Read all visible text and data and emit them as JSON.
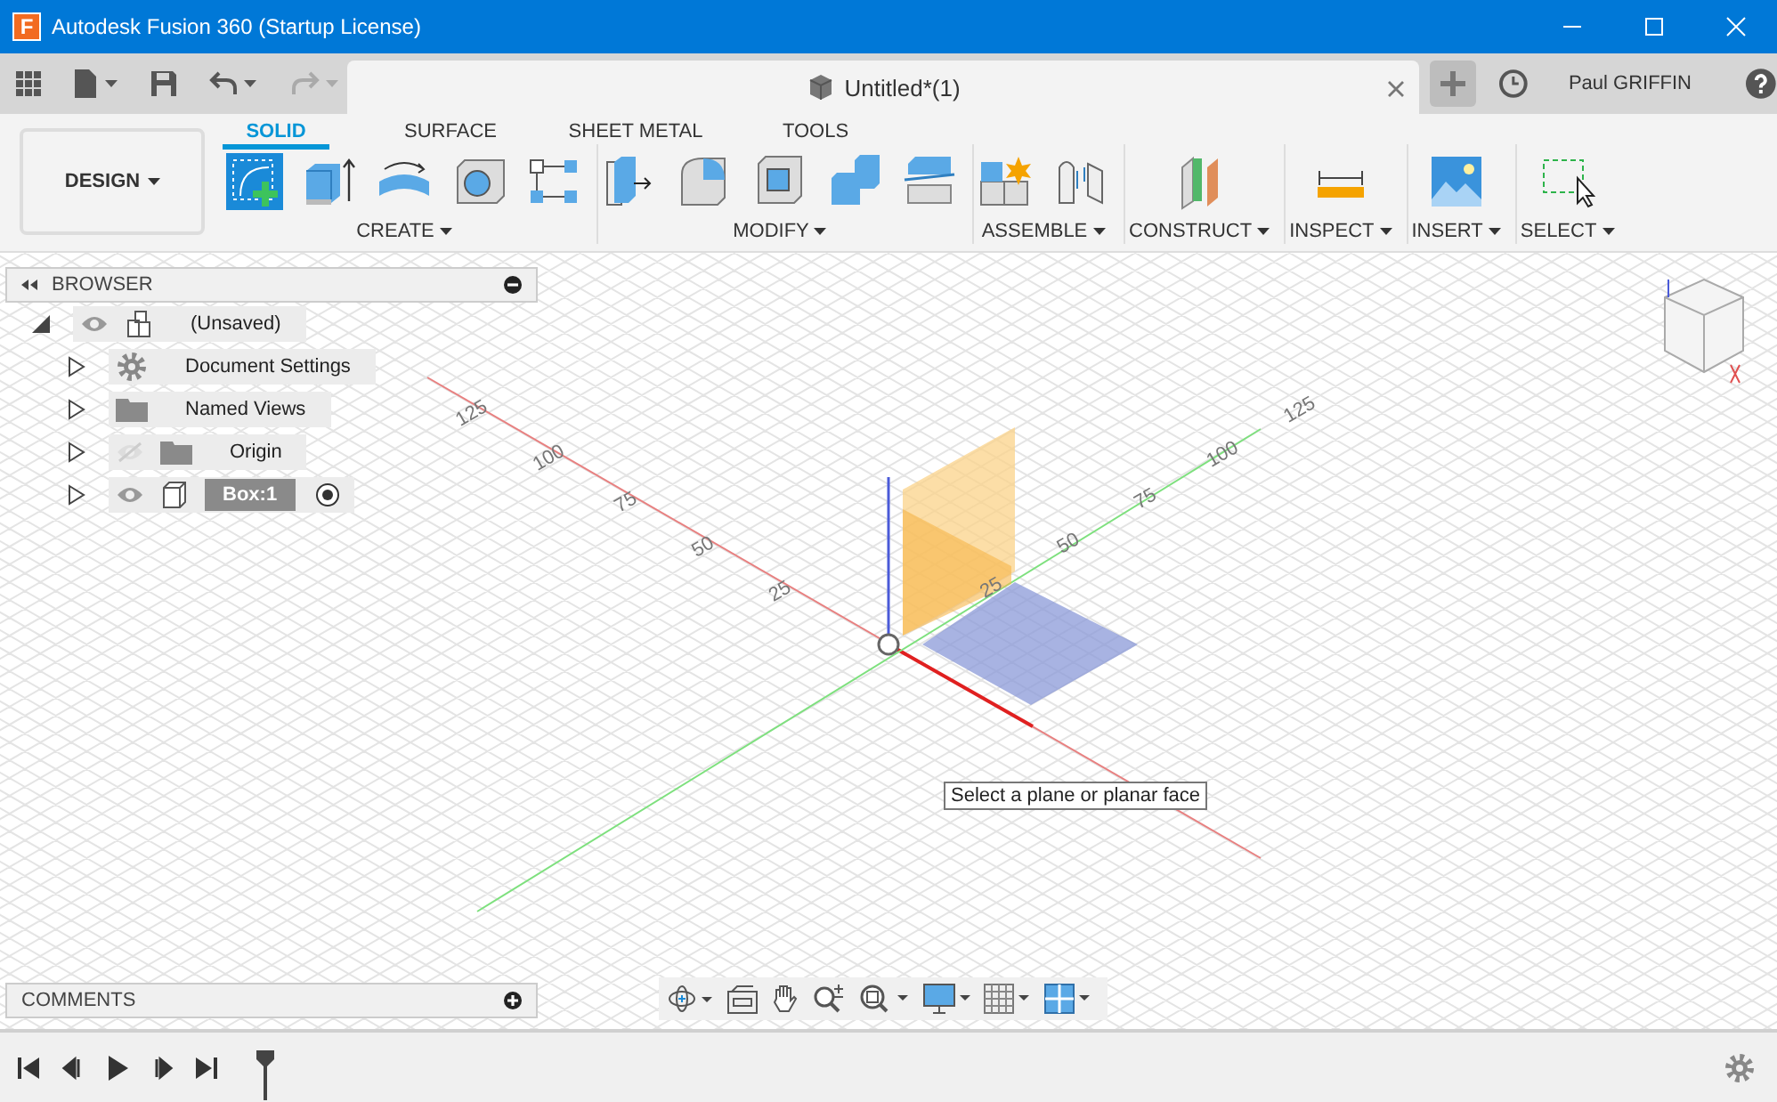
{
  "window": {
    "logo_letter": "F",
    "title": "Autodesk Fusion 360 (Startup License)"
  },
  "toolbar": {
    "undo": {
      "disabled": false
    },
    "redo": {
      "disabled": true
    },
    "document_tab": {
      "title": "Untitled*(1)"
    },
    "user": {
      "name": "Paul GRIFFIN"
    }
  },
  "workspace": {
    "label": "DESIGN"
  },
  "ribbon_tabs": [
    {
      "label": "SOLID",
      "selected": true
    },
    {
      "label": "SURFACE",
      "selected": false
    },
    {
      "label": "SHEET METAL",
      "selected": false
    },
    {
      "label": "TOOLS",
      "selected": false
    }
  ],
  "ribbon_groups": [
    {
      "label": "CREATE"
    },
    {
      "label": "MODIFY"
    },
    {
      "label": "ASSEMBLE"
    },
    {
      "label": "CONSTRUCT"
    },
    {
      "label": "INSPECT"
    },
    {
      "label": "INSERT"
    },
    {
      "label": "SELECT"
    }
  ],
  "browser": {
    "title": "BROWSER",
    "items": [
      {
        "label": "(Unsaved)",
        "kind": "component",
        "visible": true,
        "expanded": true,
        "selected": false,
        "children": [
          {
            "label": "Document Settings",
            "kind": "settings",
            "expanded": false,
            "selected": false
          },
          {
            "label": "Named Views",
            "kind": "folder",
            "expanded": false,
            "selected": false
          },
          {
            "label": "Origin",
            "kind": "folder",
            "visible": false,
            "expanded": false,
            "selected": false
          },
          {
            "label": "Box:1",
            "kind": "body",
            "visible": true,
            "expanded": false,
            "selected": true
          }
        ]
      }
    ]
  },
  "viewport": {
    "red_axis_labels": [
      "125",
      "100",
      "75",
      "50",
      "25"
    ],
    "green_axis_labels": [
      "25",
      "50",
      "75",
      "100",
      "125"
    ],
    "tooltip": "Select a plane or planar face"
  },
  "comments": {
    "title": "COMMENTS"
  }
}
